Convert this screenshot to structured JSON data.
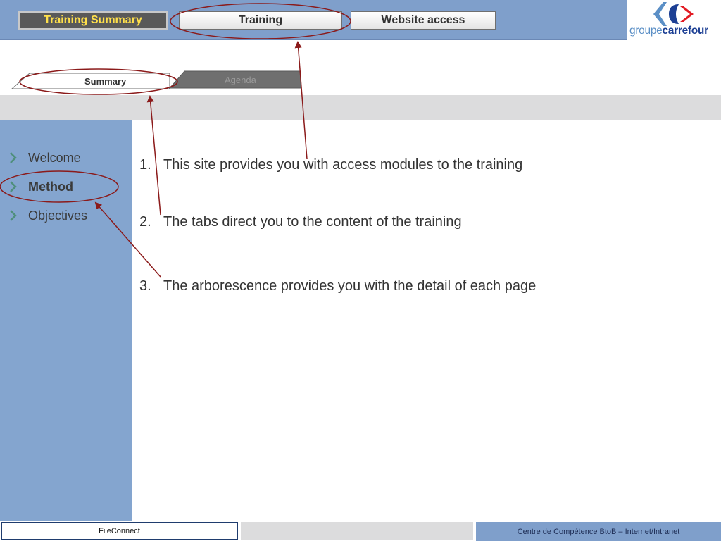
{
  "header": {
    "tabs": [
      {
        "label": "Training Summary"
      },
      {
        "label": "Training"
      },
      {
        "label": "Website access"
      }
    ],
    "logo": {
      "part1": "groupe",
      "part2": "carrefour"
    }
  },
  "subtabs": [
    {
      "label": "Summary"
    },
    {
      "label": "Agenda"
    }
  ],
  "sidebar": {
    "items": [
      {
        "label": "Welcome"
      },
      {
        "label": "Method"
      },
      {
        "label": "Objectives"
      }
    ]
  },
  "content": {
    "items": [
      {
        "num": "1.",
        "text": "This site provides you with access modules to the training"
      },
      {
        "num": "2.",
        "text": "The tabs direct you to the content of the training"
      },
      {
        "num": "3.",
        "text": "The arborescence provides you with the detail of each page"
      }
    ]
  },
  "footer": {
    "left": "FileConnect",
    "right": "Centre de Compétence BtoB – Internet/Intranet"
  },
  "colors": {
    "header_bg": "#7f9fcb",
    "sidebar_bg": "#84a5cf",
    "active_tab_text": "#ffe04a",
    "annotation": "#8b1a1a"
  }
}
